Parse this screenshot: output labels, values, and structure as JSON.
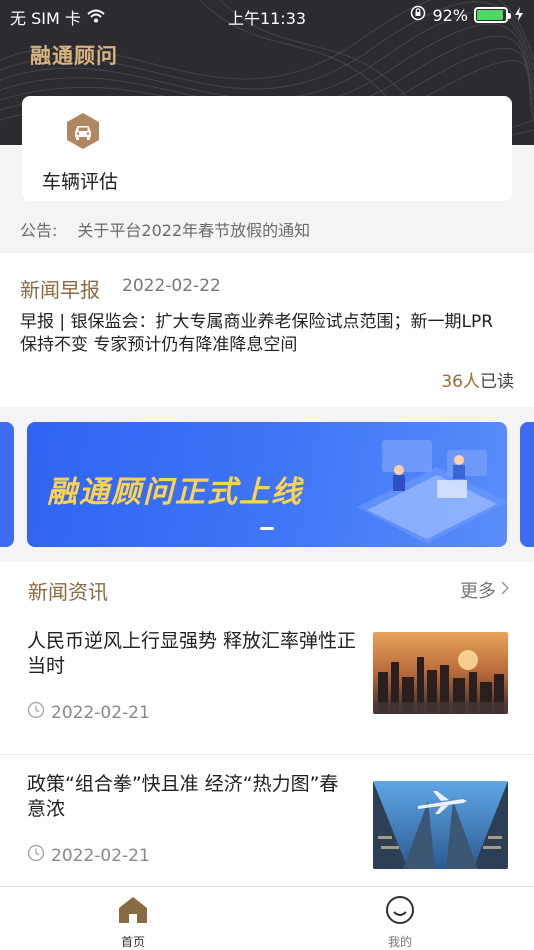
{
  "status_bar": {
    "carrier": "无 SIM 卡",
    "time": "上午11:33",
    "battery": "92%"
  },
  "header": {
    "app_title": "融通顾问"
  },
  "service": {
    "label": "车辆评估",
    "icon": "car-icon"
  },
  "notice": {
    "label": "公告:",
    "text": "关于平台2022年春节放假的通知"
  },
  "morning_news": {
    "title": "新闻早报",
    "date": "2022-02-22",
    "body": "早报 | 银保监会：扩大专属商业养老保险试点范围；新一期LPR保持不变 专家预计仍有降准降息空间",
    "read_count": "36人",
    "read_suffix": "已读"
  },
  "banner": {
    "text": "融通顾问正式上线"
  },
  "news": {
    "section_title": "新闻资讯",
    "more_label": "更多",
    "items": [
      {
        "title": "人民币逆风上行显强势 释放汇率弹性正当时",
        "date": "2022-02-21"
      },
      {
        "title": "政策“组合拳”快且准 经济“热力图”春意浓",
        "date": "2022-02-21"
      }
    ]
  },
  "tabbar": {
    "home_label": "首页",
    "mine_label": "我的"
  },
  "colors": {
    "accent_gold": "#8a6a42",
    "header_bg": "#2c2b30",
    "banner_blue": "#3f77f6",
    "banner_text": "#ffd34d"
  }
}
